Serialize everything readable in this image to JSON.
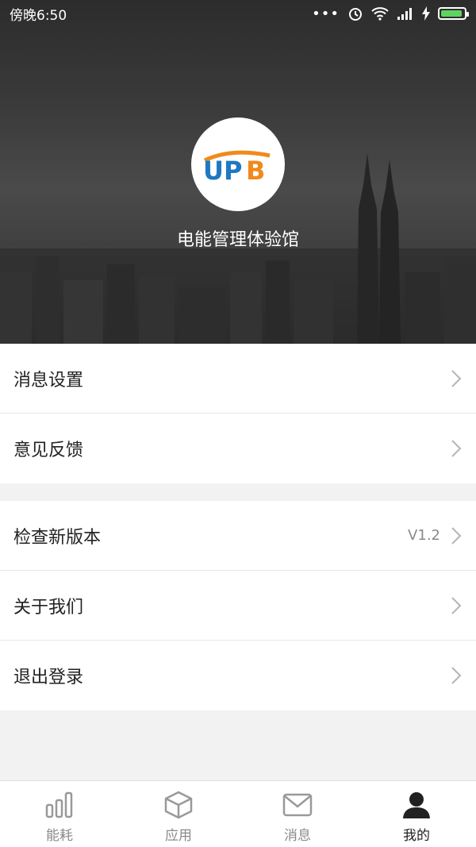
{
  "status_bar": {
    "time": "傍晚6:50"
  },
  "profile": {
    "logo_text": "UPB",
    "app_name": "电能管理体验馆"
  },
  "menu_group_1": [
    {
      "label": "消息设置"
    },
    {
      "label": "意见反馈"
    }
  ],
  "menu_group_2": [
    {
      "label": "检查新版本",
      "value": "V1.2"
    },
    {
      "label": "关于我们"
    },
    {
      "label": "退出登录"
    }
  ],
  "tabs": [
    {
      "label": "能耗",
      "icon": "bar-chart-icon",
      "active": false
    },
    {
      "label": "应用",
      "icon": "box-icon",
      "active": false
    },
    {
      "label": "消息",
      "icon": "mail-icon",
      "active": false
    },
    {
      "label": "我的",
      "icon": "person-icon",
      "active": true
    }
  ],
  "colors": {
    "logo_blue": "#1f78c1",
    "logo_orange": "#f08a1c",
    "battery_green": "#5fd35f"
  }
}
